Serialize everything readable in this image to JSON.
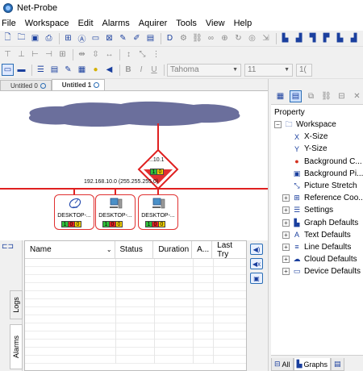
{
  "window": {
    "title": "Net-Probe"
  },
  "menu": [
    "File",
    "Workspace",
    "Edit",
    "Alarms",
    "Aquirer",
    "Tools",
    "View",
    "Help"
  ],
  "format_toolbar": {
    "bold": "B",
    "italic": "I",
    "underline": "U",
    "font": "Tahoma",
    "size": "11",
    "extra": "1("
  },
  "tabs": [
    {
      "label": "Untitled 0",
      "active": false
    },
    {
      "label": "Untitled 1",
      "active": true
    }
  ],
  "map": {
    "router": {
      "label": "...10.1",
      "status": [
        "1",
        "0"
      ]
    },
    "network_label": "192.168.10.0 (255.255.255.0)",
    "devices": [
      {
        "name": "DESKTOP-...",
        "icon": "satellite-dish-icon",
        "status": [
          "1",
          "0",
          "0"
        ]
      },
      {
        "name": "DESKTOP-...",
        "icon": "computer-icon",
        "status": [
          "1",
          "0",
          "0"
        ]
      },
      {
        "name": "DESKTOP-...",
        "icon": "computer-icon",
        "status": [
          "1",
          "0",
          "0"
        ]
      }
    ],
    "colors": {
      "cloud": "#6b6f9c",
      "link": "#e02020",
      "ok": "#2fbf3a",
      "warn": "#f2d000",
      "alarm": "#e52323"
    }
  },
  "bottom_panel": {
    "vertical_tabs": [
      "Logs",
      "Alarms"
    ],
    "columns": [
      "Name",
      "Status",
      "Duration",
      "A...",
      "Last Try"
    ]
  },
  "property_panel": {
    "header": "Property",
    "tree": [
      {
        "label": "Workspace",
        "level": 0,
        "expander": "−",
        "icon": "folder-icon"
      },
      {
        "label": "X-Size",
        "level": 1,
        "expander": "",
        "icon": "x-size-icon"
      },
      {
        "label": "Y-Size",
        "level": 1,
        "expander": "",
        "icon": "y-size-icon"
      },
      {
        "label": "Background C...",
        "level": 1,
        "expander": "",
        "icon": "palette-icon"
      },
      {
        "label": "Background Pi...",
        "level": 1,
        "expander": "",
        "icon": "picture-icon"
      },
      {
        "label": "Picture Stretch",
        "level": 1,
        "expander": "",
        "icon": "stretch-icon"
      },
      {
        "label": "Reference Coo...",
        "level": 1,
        "expander": "+",
        "icon": "reference-icon"
      },
      {
        "label": "Settings",
        "level": 1,
        "expander": "+",
        "icon": "settings-icon"
      },
      {
        "label": "Graph Defaults",
        "level": 1,
        "expander": "+",
        "icon": "graph-icon"
      },
      {
        "label": "Text Defaults",
        "level": 1,
        "expander": "+",
        "icon": "text-icon"
      },
      {
        "label": "Line Defaults",
        "level": 1,
        "expander": "+",
        "icon": "line-icon"
      },
      {
        "label": "Cloud Defaults",
        "level": 1,
        "expander": "+",
        "icon": "cloud-icon"
      },
      {
        "label": "Device Defaults",
        "level": 1,
        "expander": "+",
        "icon": "device-icon"
      }
    ],
    "bottom_tabs": [
      "All",
      "Graphs",
      ""
    ]
  }
}
